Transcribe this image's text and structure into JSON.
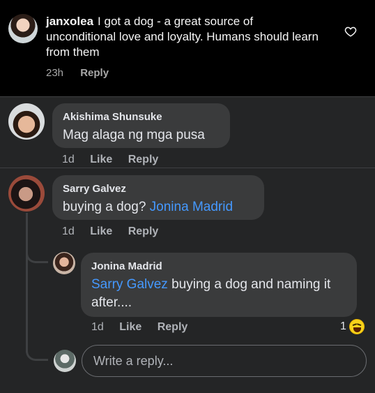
{
  "post": {
    "username": "janxolea",
    "text": "I got a dog - a great source of unconditional love and loyalty. Humans should learn from them",
    "time": "23h",
    "reply_label": "Reply",
    "like_icon": "heart-outline-icon"
  },
  "comments": [
    {
      "author": "Akishima Shunsuke",
      "text": "Mag alaga ng mga pusa",
      "time": "1d",
      "like_label": "Like",
      "reply_label": "Reply"
    },
    {
      "author": "Sarry Galvez",
      "text": "buying a dog?",
      "mention": "Jonina Madrid",
      "time": "1d",
      "like_label": "Like",
      "reply_label": "Reply",
      "replies": [
        {
          "author": "Jonina Madrid",
          "mention": "Sarry Galvez",
          "text": "buying a dog and naming it after....",
          "time": "1d",
          "like_label": "Like",
          "reply_label": "Reply",
          "reaction_count": "1",
          "reaction_icon": "haha-emoji-icon"
        }
      ]
    }
  ],
  "reply_box": {
    "placeholder": "Write a reply..."
  },
  "colors": {
    "mention": "#4599ff",
    "bubble": "#3a3b3c",
    "background": "#242526"
  }
}
